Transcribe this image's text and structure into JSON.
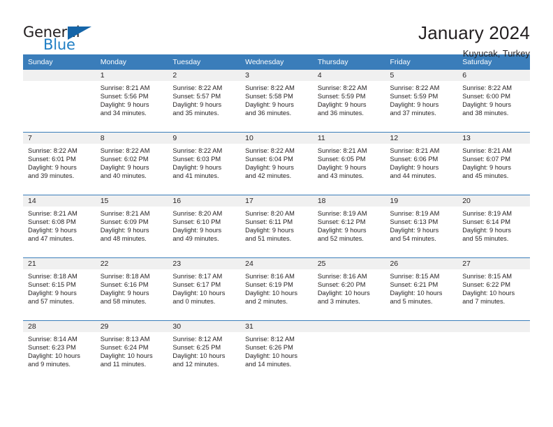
{
  "brand": {
    "word_one": "General",
    "word_two": "Blue",
    "triangle_icon": "triangle-icon",
    "color_dark": "#231f20",
    "color_blue": "#1f7ec4"
  },
  "header": {
    "title": "January 2024",
    "subtitle": "Kuyucak, Turkey"
  },
  "theme": {
    "header_bg": "#3a7dba",
    "header_text": "#ffffff",
    "daynum_bg": "#f0f0f0",
    "cell_bg": "#ffffff",
    "text": "#231f20"
  },
  "calendar": {
    "weekday_headers": [
      "Sunday",
      "Monday",
      "Tuesday",
      "Wednesday",
      "Thursday",
      "Friday",
      "Saturday"
    ],
    "weeks": [
      [
        {
          "day": "",
          "lines": []
        },
        {
          "day": "1",
          "lines": [
            "Sunrise: 8:21 AM",
            "Sunset: 5:56 PM",
            "Daylight: 9 hours",
            "and 34 minutes."
          ]
        },
        {
          "day": "2",
          "lines": [
            "Sunrise: 8:22 AM",
            "Sunset: 5:57 PM",
            "Daylight: 9 hours",
            "and 35 minutes."
          ]
        },
        {
          "day": "3",
          "lines": [
            "Sunrise: 8:22 AM",
            "Sunset: 5:58 PM",
            "Daylight: 9 hours",
            "and 36 minutes."
          ]
        },
        {
          "day": "4",
          "lines": [
            "Sunrise: 8:22 AM",
            "Sunset: 5:59 PM",
            "Daylight: 9 hours",
            "and 36 minutes."
          ]
        },
        {
          "day": "5",
          "lines": [
            "Sunrise: 8:22 AM",
            "Sunset: 5:59 PM",
            "Daylight: 9 hours",
            "and 37 minutes."
          ]
        },
        {
          "day": "6",
          "lines": [
            "Sunrise: 8:22 AM",
            "Sunset: 6:00 PM",
            "Daylight: 9 hours",
            "and 38 minutes."
          ]
        }
      ],
      [
        {
          "day": "7",
          "lines": [
            "Sunrise: 8:22 AM",
            "Sunset: 6:01 PM",
            "Daylight: 9 hours",
            "and 39 minutes."
          ]
        },
        {
          "day": "8",
          "lines": [
            "Sunrise: 8:22 AM",
            "Sunset: 6:02 PM",
            "Daylight: 9 hours",
            "and 40 minutes."
          ]
        },
        {
          "day": "9",
          "lines": [
            "Sunrise: 8:22 AM",
            "Sunset: 6:03 PM",
            "Daylight: 9 hours",
            "and 41 minutes."
          ]
        },
        {
          "day": "10",
          "lines": [
            "Sunrise: 8:22 AM",
            "Sunset: 6:04 PM",
            "Daylight: 9 hours",
            "and 42 minutes."
          ]
        },
        {
          "day": "11",
          "lines": [
            "Sunrise: 8:21 AM",
            "Sunset: 6:05 PM",
            "Daylight: 9 hours",
            "and 43 minutes."
          ]
        },
        {
          "day": "12",
          "lines": [
            "Sunrise: 8:21 AM",
            "Sunset: 6:06 PM",
            "Daylight: 9 hours",
            "and 44 minutes."
          ]
        },
        {
          "day": "13",
          "lines": [
            "Sunrise: 8:21 AM",
            "Sunset: 6:07 PM",
            "Daylight: 9 hours",
            "and 45 minutes."
          ]
        }
      ],
      [
        {
          "day": "14",
          "lines": [
            "Sunrise: 8:21 AM",
            "Sunset: 6:08 PM",
            "Daylight: 9 hours",
            "and 47 minutes."
          ]
        },
        {
          "day": "15",
          "lines": [
            "Sunrise: 8:21 AM",
            "Sunset: 6:09 PM",
            "Daylight: 9 hours",
            "and 48 minutes."
          ]
        },
        {
          "day": "16",
          "lines": [
            "Sunrise: 8:20 AM",
            "Sunset: 6:10 PM",
            "Daylight: 9 hours",
            "and 49 minutes."
          ]
        },
        {
          "day": "17",
          "lines": [
            "Sunrise: 8:20 AM",
            "Sunset: 6:11 PM",
            "Daylight: 9 hours",
            "and 51 minutes."
          ]
        },
        {
          "day": "18",
          "lines": [
            "Sunrise: 8:19 AM",
            "Sunset: 6:12 PM",
            "Daylight: 9 hours",
            "and 52 minutes."
          ]
        },
        {
          "day": "19",
          "lines": [
            "Sunrise: 8:19 AM",
            "Sunset: 6:13 PM",
            "Daylight: 9 hours",
            "and 54 minutes."
          ]
        },
        {
          "day": "20",
          "lines": [
            "Sunrise: 8:19 AM",
            "Sunset: 6:14 PM",
            "Daylight: 9 hours",
            "and 55 minutes."
          ]
        }
      ],
      [
        {
          "day": "21",
          "lines": [
            "Sunrise: 8:18 AM",
            "Sunset: 6:15 PM",
            "Daylight: 9 hours",
            "and 57 minutes."
          ]
        },
        {
          "day": "22",
          "lines": [
            "Sunrise: 8:18 AM",
            "Sunset: 6:16 PM",
            "Daylight: 9 hours",
            "and 58 minutes."
          ]
        },
        {
          "day": "23",
          "lines": [
            "Sunrise: 8:17 AM",
            "Sunset: 6:17 PM",
            "Daylight: 10 hours",
            "and 0 minutes."
          ]
        },
        {
          "day": "24",
          "lines": [
            "Sunrise: 8:16 AM",
            "Sunset: 6:19 PM",
            "Daylight: 10 hours",
            "and 2 minutes."
          ]
        },
        {
          "day": "25",
          "lines": [
            "Sunrise: 8:16 AM",
            "Sunset: 6:20 PM",
            "Daylight: 10 hours",
            "and 3 minutes."
          ]
        },
        {
          "day": "26",
          "lines": [
            "Sunrise: 8:15 AM",
            "Sunset: 6:21 PM",
            "Daylight: 10 hours",
            "and 5 minutes."
          ]
        },
        {
          "day": "27",
          "lines": [
            "Sunrise: 8:15 AM",
            "Sunset: 6:22 PM",
            "Daylight: 10 hours",
            "and 7 minutes."
          ]
        }
      ],
      [
        {
          "day": "28",
          "lines": [
            "Sunrise: 8:14 AM",
            "Sunset: 6:23 PM",
            "Daylight: 10 hours",
            "and 9 minutes."
          ]
        },
        {
          "day": "29",
          "lines": [
            "Sunrise: 8:13 AM",
            "Sunset: 6:24 PM",
            "Daylight: 10 hours",
            "and 11 minutes."
          ]
        },
        {
          "day": "30",
          "lines": [
            "Sunrise: 8:12 AM",
            "Sunset: 6:25 PM",
            "Daylight: 10 hours",
            "and 12 minutes."
          ]
        },
        {
          "day": "31",
          "lines": [
            "Sunrise: 8:12 AM",
            "Sunset: 6:26 PM",
            "Daylight: 10 hours",
            "and 14 minutes."
          ]
        },
        {
          "day": "",
          "lines": []
        },
        {
          "day": "",
          "lines": []
        },
        {
          "day": "",
          "lines": []
        }
      ]
    ]
  }
}
